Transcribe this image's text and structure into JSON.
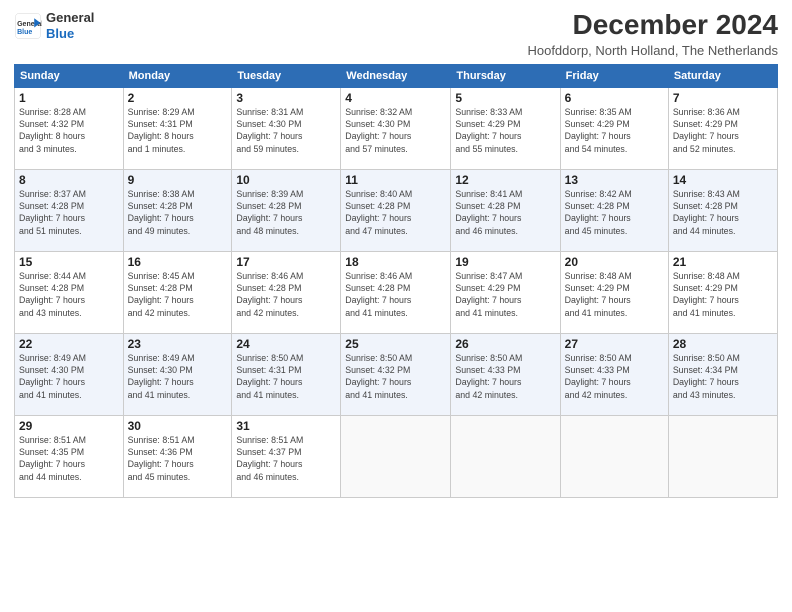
{
  "header": {
    "logo_line1": "General",
    "logo_line2": "Blue",
    "title": "December 2024",
    "subtitle": "Hoofddorp, North Holland, The Netherlands"
  },
  "days_of_week": [
    "Sunday",
    "Monday",
    "Tuesday",
    "Wednesday",
    "Thursday",
    "Friday",
    "Saturday"
  ],
  "weeks": [
    [
      {
        "day": "1",
        "sunrise": "8:28 AM",
        "sunset": "4:32 PM",
        "daylight_hours": "8",
        "daylight_minutes": "3"
      },
      {
        "day": "2",
        "sunrise": "8:29 AM",
        "sunset": "4:31 PM",
        "daylight_hours": "8",
        "daylight_minutes": "1"
      },
      {
        "day": "3",
        "sunrise": "8:31 AM",
        "sunset": "4:30 PM",
        "daylight_hours": "7",
        "daylight_minutes": "59"
      },
      {
        "day": "4",
        "sunrise": "8:32 AM",
        "sunset": "4:30 PM",
        "daylight_hours": "7",
        "daylight_minutes": "57"
      },
      {
        "day": "5",
        "sunrise": "8:33 AM",
        "sunset": "4:29 PM",
        "daylight_hours": "7",
        "daylight_minutes": "55"
      },
      {
        "day": "6",
        "sunrise": "8:35 AM",
        "sunset": "4:29 PM",
        "daylight_hours": "7",
        "daylight_minutes": "54"
      },
      {
        "day": "7",
        "sunrise": "8:36 AM",
        "sunset": "4:29 PM",
        "daylight_hours": "7",
        "daylight_minutes": "52"
      }
    ],
    [
      {
        "day": "8",
        "sunrise": "8:37 AM",
        "sunset": "4:28 PM",
        "daylight_hours": "7",
        "daylight_minutes": "51"
      },
      {
        "day": "9",
        "sunrise": "8:38 AM",
        "sunset": "4:28 PM",
        "daylight_hours": "7",
        "daylight_minutes": "49"
      },
      {
        "day": "10",
        "sunrise": "8:39 AM",
        "sunset": "4:28 PM",
        "daylight_hours": "7",
        "daylight_minutes": "48"
      },
      {
        "day": "11",
        "sunrise": "8:40 AM",
        "sunset": "4:28 PM",
        "daylight_hours": "7",
        "daylight_minutes": "47"
      },
      {
        "day": "12",
        "sunrise": "8:41 AM",
        "sunset": "4:28 PM",
        "daylight_hours": "7",
        "daylight_minutes": "46"
      },
      {
        "day": "13",
        "sunrise": "8:42 AM",
        "sunset": "4:28 PM",
        "daylight_hours": "7",
        "daylight_minutes": "45"
      },
      {
        "day": "14",
        "sunrise": "8:43 AM",
        "sunset": "4:28 PM",
        "daylight_hours": "7",
        "daylight_minutes": "44"
      }
    ],
    [
      {
        "day": "15",
        "sunrise": "8:44 AM",
        "sunset": "4:28 PM",
        "daylight_hours": "7",
        "daylight_minutes": "43"
      },
      {
        "day": "16",
        "sunrise": "8:45 AM",
        "sunset": "4:28 PM",
        "daylight_hours": "7",
        "daylight_minutes": "42"
      },
      {
        "day": "17",
        "sunrise": "8:46 AM",
        "sunset": "4:28 PM",
        "daylight_hours": "7",
        "daylight_minutes": "42"
      },
      {
        "day": "18",
        "sunrise": "8:46 AM",
        "sunset": "4:28 PM",
        "daylight_hours": "7",
        "daylight_minutes": "41"
      },
      {
        "day": "19",
        "sunrise": "8:47 AM",
        "sunset": "4:29 PM",
        "daylight_hours": "7",
        "daylight_minutes": "41"
      },
      {
        "day": "20",
        "sunrise": "8:48 AM",
        "sunset": "4:29 PM",
        "daylight_hours": "7",
        "daylight_minutes": "41"
      },
      {
        "day": "21",
        "sunrise": "8:48 AM",
        "sunset": "4:29 PM",
        "daylight_hours": "7",
        "daylight_minutes": "41"
      }
    ],
    [
      {
        "day": "22",
        "sunrise": "8:49 AM",
        "sunset": "4:30 PM",
        "daylight_hours": "7",
        "daylight_minutes": "41"
      },
      {
        "day": "23",
        "sunrise": "8:49 AM",
        "sunset": "4:30 PM",
        "daylight_hours": "7",
        "daylight_minutes": "41"
      },
      {
        "day": "24",
        "sunrise": "8:50 AM",
        "sunset": "4:31 PM",
        "daylight_hours": "7",
        "daylight_minutes": "41"
      },
      {
        "day": "25",
        "sunrise": "8:50 AM",
        "sunset": "4:32 PM",
        "daylight_hours": "7",
        "daylight_minutes": "41"
      },
      {
        "day": "26",
        "sunrise": "8:50 AM",
        "sunset": "4:33 PM",
        "daylight_hours": "7",
        "daylight_minutes": "42"
      },
      {
        "day": "27",
        "sunrise": "8:50 AM",
        "sunset": "4:33 PM",
        "daylight_hours": "7",
        "daylight_minutes": "42"
      },
      {
        "day": "28",
        "sunrise": "8:50 AM",
        "sunset": "4:34 PM",
        "daylight_hours": "7",
        "daylight_minutes": "43"
      }
    ],
    [
      {
        "day": "29",
        "sunrise": "8:51 AM",
        "sunset": "4:35 PM",
        "daylight_hours": "7",
        "daylight_minutes": "44"
      },
      {
        "day": "30",
        "sunrise": "8:51 AM",
        "sunset": "4:36 PM",
        "daylight_hours": "7",
        "daylight_minutes": "45"
      },
      {
        "day": "31",
        "sunrise": "8:51 AM",
        "sunset": "4:37 PM",
        "daylight_hours": "7",
        "daylight_minutes": "46"
      },
      null,
      null,
      null,
      null
    ]
  ]
}
